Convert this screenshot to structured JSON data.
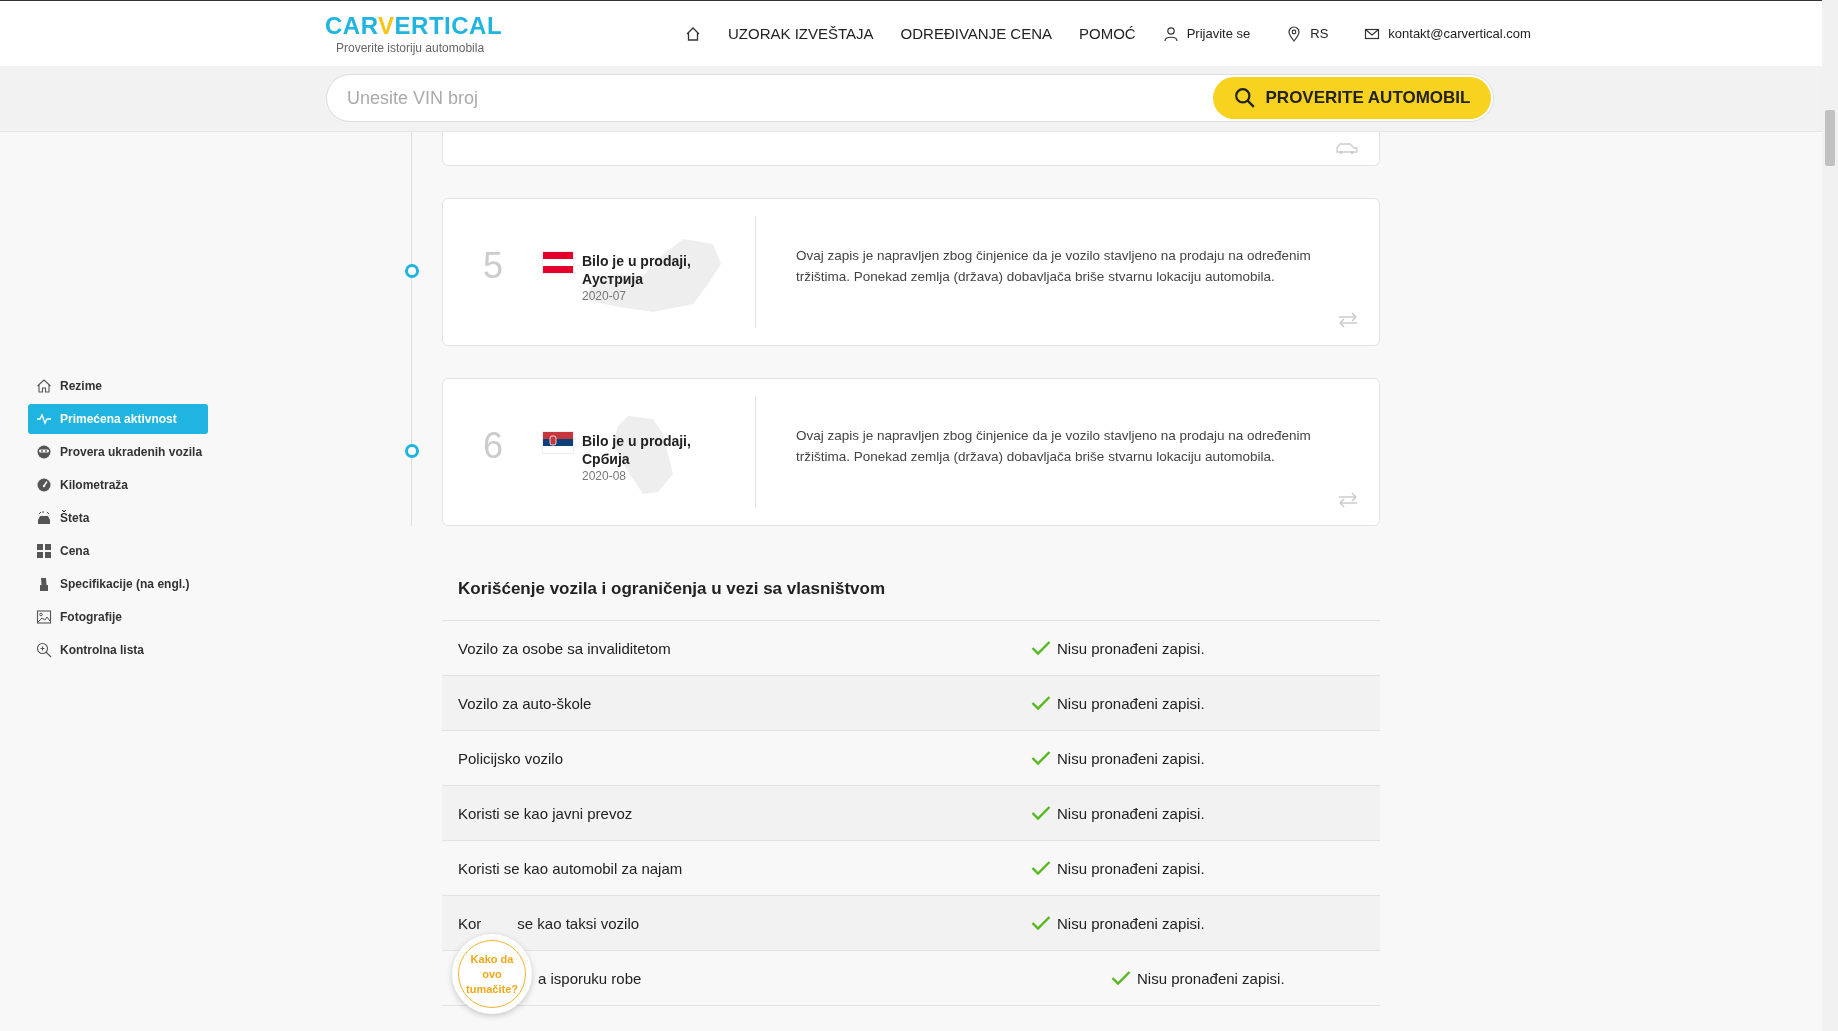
{
  "header": {
    "logo": {
      "before": "CAR",
      "accent": "V",
      "after": "ERTICAL"
    },
    "tagline": "Proverite istoriju automobila",
    "nav": [
      "UZORAK IZVEŠTAJA",
      "ODREĐIVANJE CENA",
      "POMOĆ"
    ],
    "login": "Prijavite se",
    "region": "RS",
    "email": "kontakt@carvertical.com"
  },
  "search": {
    "placeholder": "Unesite VIN broj",
    "button": "PROVERITE AUTOMOBIL"
  },
  "sidebar": {
    "items": [
      {
        "label": "Rezime",
        "selected": false
      },
      {
        "label": "Primećena aktivnost",
        "selected": true
      },
      {
        "label": "Provera ukradenih vozila",
        "selected": false
      },
      {
        "label": "Kilometraža",
        "selected": false
      },
      {
        "label": "Šteta",
        "selected": false
      },
      {
        "label": "Cena",
        "selected": false
      },
      {
        "label": "Specifikacije (na engl.)",
        "selected": false
      },
      {
        "label": "Fotografije",
        "selected": false
      },
      {
        "label": "Kontrolna lista",
        "selected": false
      }
    ]
  },
  "timeline": [
    {
      "number": "5",
      "title": "Bilo je u prodaji, Аустрија",
      "date": "2020-07",
      "text": "Ovaj zapis je napravljen zbog činjenice da je vozilo stavljeno na prodaju na određenim tržištima. Ponekad zemlja (država) dobavljača briše stvarnu lokaciju automobila."
    },
    {
      "number": "6",
      "title": "Bilo je u prodaji, Србија",
      "date": "2020-08",
      "text": "Ovaj zapis je napravljen zbog činjenice da je vozilo stavljeno na prodaju na određenim tržištima. Ponekad zemlja (država) dobavljača briše stvarnu lokaciju automobila."
    }
  ],
  "usage": {
    "title": "Korišćenje vozila i ograničenja u vezi sa vlasništvom",
    "rows": [
      {
        "label_parts": [
          "Vozilo za osobe sa invaliditetom"
        ],
        "covered": false,
        "status": "Nisu pronađeni zapisi."
      },
      {
        "label_parts": [
          "Vozilo za auto-škole"
        ],
        "covered": false,
        "status": "Nisu pronađeni zapisi."
      },
      {
        "label_parts": [
          "Policijsko vozilo"
        ],
        "covered": false,
        "status": "Nisu pronađeni zapisi."
      },
      {
        "label_parts": [
          "Koristi se kao javni prevoz"
        ],
        "covered": false,
        "status": "Nisu pronađeni zapisi."
      },
      {
        "label_parts": [
          "Koristi se kao automobil za najam"
        ],
        "covered": false,
        "status": "Nisu pronađeni zapisi."
      },
      {
        "label_parts": [
          "Kor",
          "se kao taksi vozilo"
        ],
        "covered": false,
        "status": "Nisu pronađeni zapisi."
      },
      {
        "label_parts": [
          "a isporuku robe"
        ],
        "covered": true,
        "status": "Nisu pronađeni zapisi."
      }
    ]
  },
  "help_badge": "Kako da ovo tumačite?"
}
